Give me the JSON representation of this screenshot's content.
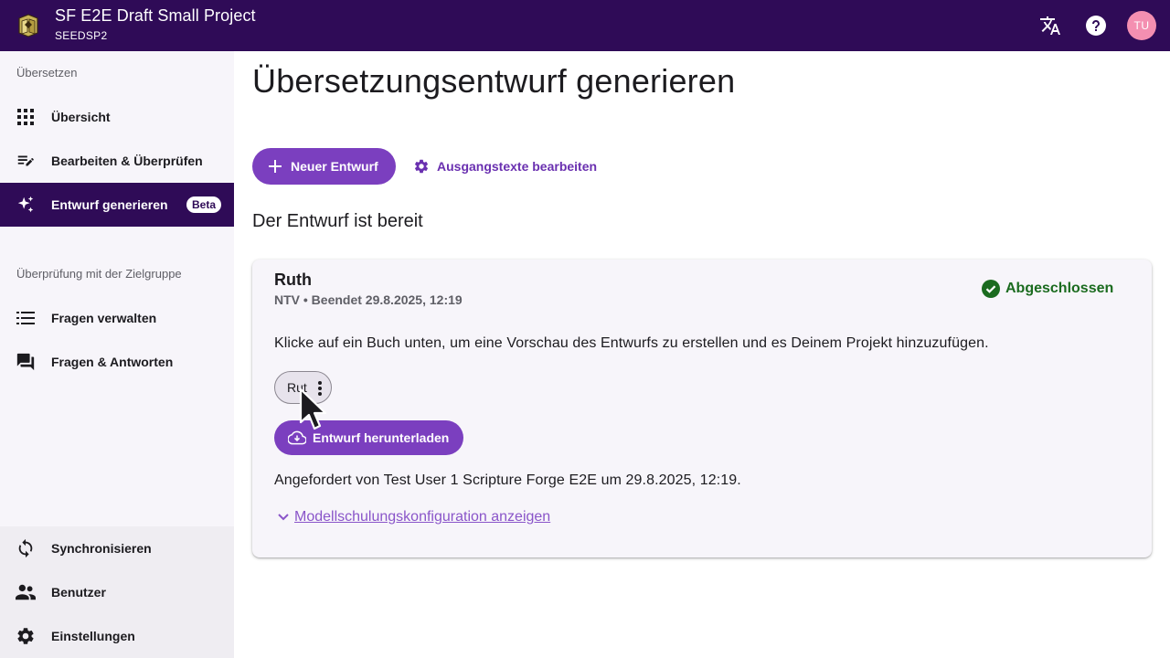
{
  "header": {
    "project_title": "SF E2E Draft Small Project",
    "project_code": "SEEDSP2",
    "avatar_initials": "TU",
    "icons": [
      "translate-icon",
      "help-icon"
    ]
  },
  "sidebar": {
    "section_translate": "Übersetzen",
    "items_translate": [
      {
        "label": "Übersicht",
        "icon": "grid-icon"
      },
      {
        "label": "Bearbeiten & Überprüfen",
        "icon": "edit-note-icon"
      },
      {
        "label": "Entwurf generieren",
        "icon": "sparkle-icon",
        "badge": "Beta",
        "active": true
      }
    ],
    "section_community": "Überprüfung mit der Zielgruppe",
    "items_community": [
      {
        "label": "Fragen verwalten",
        "icon": "list-icon"
      },
      {
        "label": "Fragen & Antworten",
        "icon": "forum-icon"
      }
    ],
    "items_bottom": [
      {
        "label": "Synchronisieren",
        "icon": "sync-icon"
      },
      {
        "label": "Benutzer",
        "icon": "people-icon"
      },
      {
        "label": "Einstellungen",
        "icon": "gear-icon"
      }
    ]
  },
  "main": {
    "page_title": "Übersetzungsentwurf generieren",
    "new_draft_label": "Neuer Entwurf",
    "edit_sources_label": "Ausgangstexte bearbeiten",
    "section_heading": "Der Entwurf ist bereit",
    "card": {
      "title": "Ruth",
      "subtitle": "NTV • Beendet 29.8.2025, 12:19",
      "status": "Abgeschlossen",
      "instruction": "Klicke auf ein Buch unten, um eine Vorschau des Entwurfs zu erstellen und es Deinem Projekt hinzuzufügen.",
      "book_chip": "Rut",
      "download_label": "Entwurf herunterladen",
      "requested_by": "Angefordert von Test User 1 Scripture Forge E2E um 29.8.2025, 12:19.",
      "model_config_link": "Modellschulungskonfiguration anzeigen"
    }
  },
  "colors": {
    "topbar": "#2f0b57",
    "primary": "#7b3fbf",
    "status_green": "#1b6b1f",
    "avatar": "#f48fb1"
  }
}
